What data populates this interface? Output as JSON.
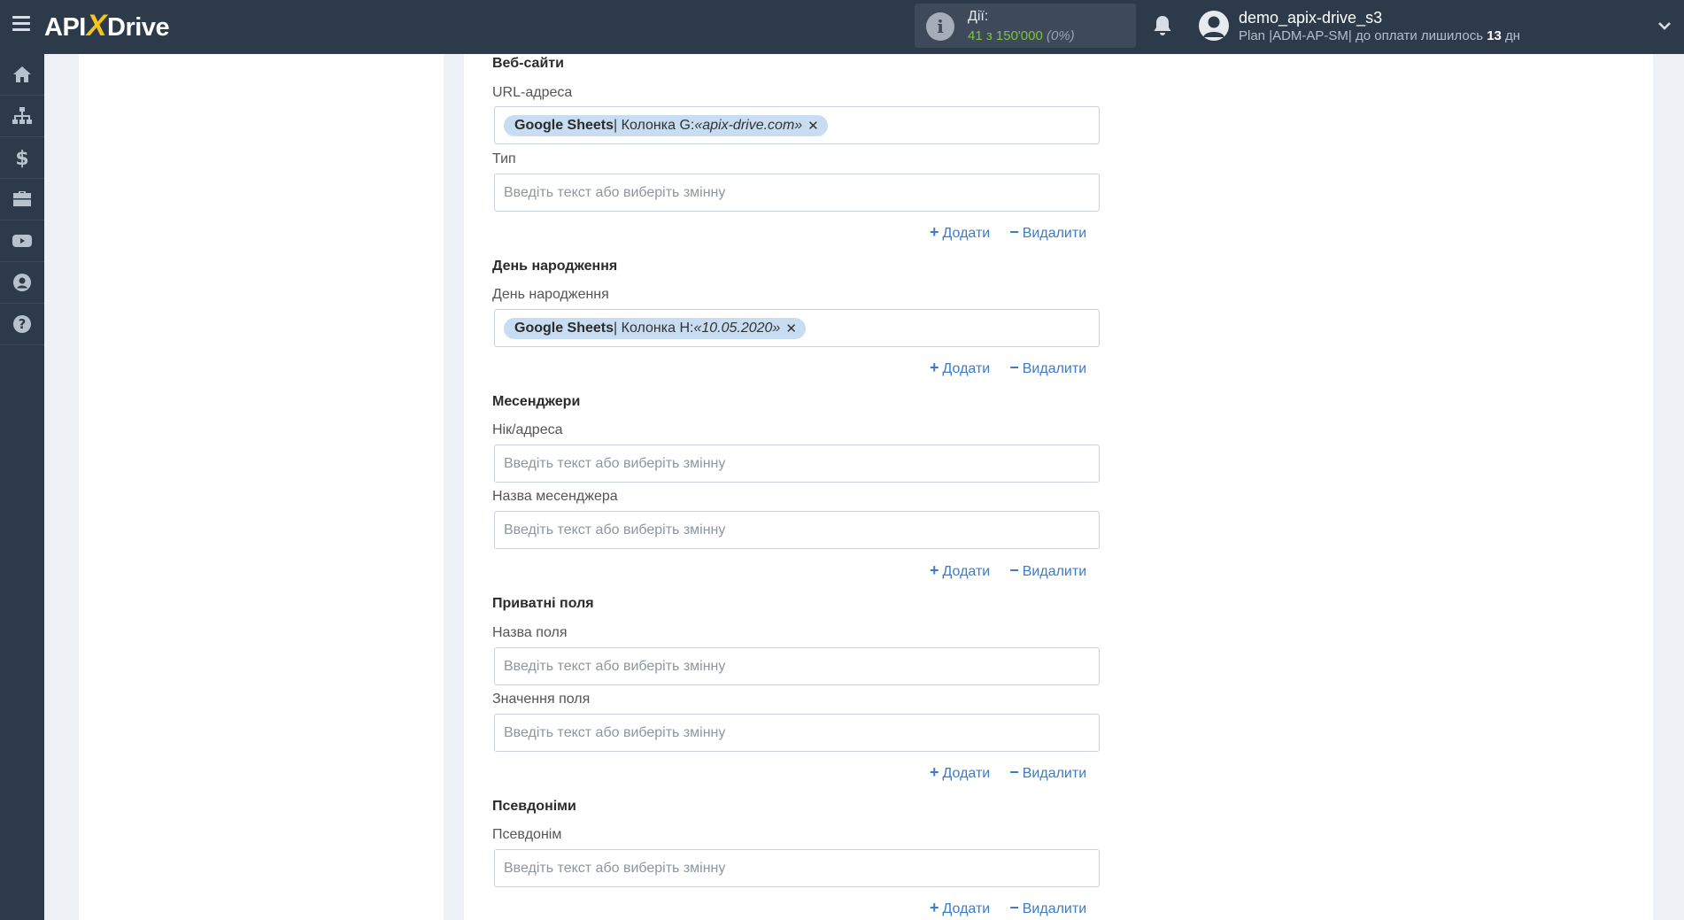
{
  "header": {
    "logo_left": "API",
    "logo_x": "X",
    "logo_right": "Drive",
    "actions_label": "Дії:",
    "actions_used": "41",
    "actions_sep": " з ",
    "actions_total": "150'000",
    "actions_percent": "(0%)",
    "user_name": "demo_apix-drive_s3",
    "plan_text": "Plan |ADM-AP-SM| до оплати лишилось ",
    "plan_days": "13",
    "plan_days_unit": " дн"
  },
  "sidebar": {
    "items": [
      "home-icon",
      "sitemap-icon",
      "dollar-icon",
      "briefcase-icon",
      "youtube-icon",
      "user-circle-icon",
      "question-icon"
    ]
  },
  "form": {
    "placeholder": "Введіть текст або виберіть змінну",
    "add_label": "Додати",
    "remove_label": "Видалити",
    "websites": {
      "title": "Веб-сайти",
      "url_label": "URL-адреса",
      "url_chip_source": "Google Sheets",
      "url_chip_column": " | Колонка G: ",
      "url_chip_value": "«apix-drive.com»",
      "type_label": "Тип"
    },
    "birthday": {
      "title": "День народження",
      "label": "День народження",
      "chip_source": "Google Sheets",
      "chip_column": " | Колонка H: ",
      "chip_value": "«10.05.2020»"
    },
    "messengers": {
      "title": "Месенджери",
      "nick_label": "Нік/адреса",
      "name_label": "Назва месенджера"
    },
    "private_fields": {
      "title": "Приватні поля",
      "name_label": "Назва поля",
      "value_label": "Значення поля"
    },
    "aliases": {
      "title": "Псевдоніми",
      "label": "Псевдонім"
    }
  },
  "colors": {
    "topbar": "#2d3a4a",
    "accent_link": "#3b7cc6",
    "chip_bg": "#c8dcf2",
    "actions_green": "#7ec242",
    "logo_x": "#f5c518"
  }
}
